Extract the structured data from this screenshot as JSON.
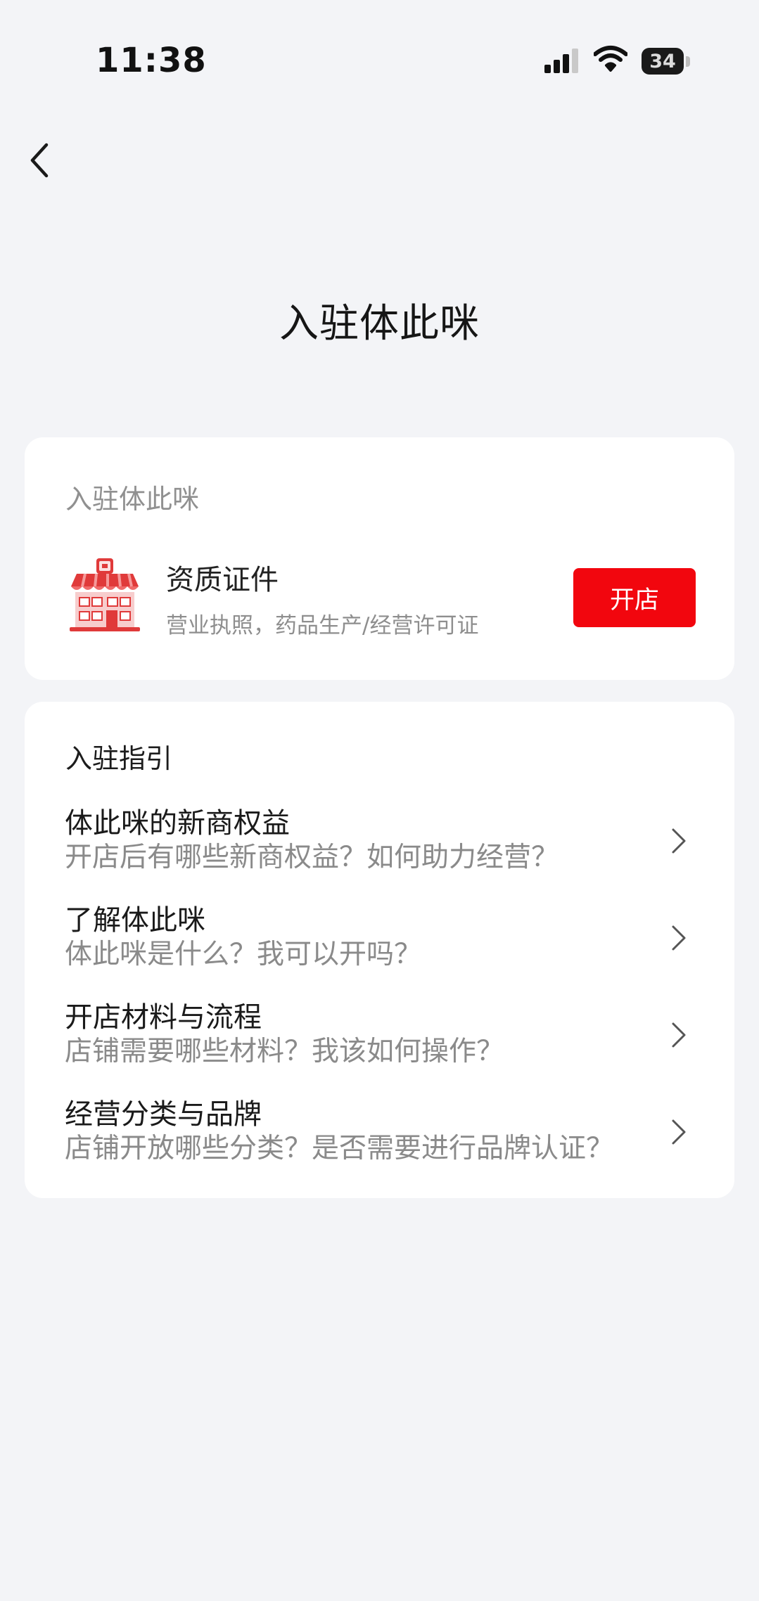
{
  "status_bar": {
    "time": "11:38",
    "battery": "34",
    "icons": [
      "signal-icon",
      "wifi-icon",
      "battery-icon"
    ]
  },
  "nav": {
    "back_icon": "chevron-left-icon"
  },
  "page_title": "入驻体此咪",
  "shop_card": {
    "header": "入驻体此咪",
    "icon": "storefront-icon",
    "qualification_title": "资质证件",
    "qualification_subtitle": "营业执照，药品生产/经营许可证",
    "open_button_label": "开店"
  },
  "guide_card": {
    "header": "入驻指引",
    "items": [
      {
        "title": "体此咪的新商权益",
        "subtitle": "开店后有哪些新商权益？如何助力经营？"
      },
      {
        "title": "了解体此咪",
        "subtitle": "体此咪是什么？我可以开吗？"
      },
      {
        "title": "开店材料与流程",
        "subtitle": "店铺需要哪些材料？我该如何操作？"
      },
      {
        "title": "经营分类与品牌",
        "subtitle": "店铺开放哪些分类？是否需要进行品牌认证？"
      }
    ]
  },
  "colors": {
    "background": "#f3f4f7",
    "card": "#ffffff",
    "accent": "#f2060e",
    "primary_text": "#1a1a1a",
    "secondary_text": "#8a8a8a"
  }
}
